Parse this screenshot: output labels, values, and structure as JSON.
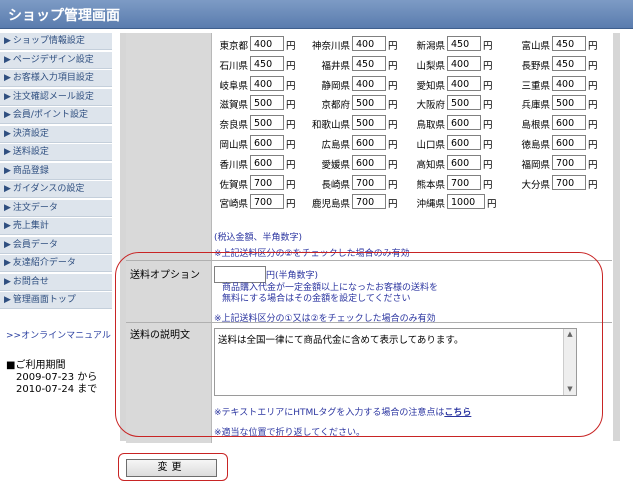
{
  "header": {
    "title": "ショップ管理画面"
  },
  "sidebar": {
    "items": [
      "ショップ情報設定",
      "ページデザイン設定",
      "お客様入力項目設定",
      "注文確認メール設定",
      "会員/ポイント設定",
      "決済設定",
      "送料設定",
      "商品登録",
      "ガイダンスの設定",
      "注文データ",
      "売上集計",
      "会員データ",
      "友達紹介データ",
      "お問合せ",
      "管理画面トップ"
    ],
    "manual": ">>オンラインマニュアル",
    "period_title": "■ご利用期間",
    "period_from": "2009-07-23  から",
    "period_to": "2010-07-24  まで"
  },
  "shipping": {
    "yen": "円",
    "rows": [
      [
        [
          "東京都",
          "400"
        ],
        [
          "神奈川県",
          "400"
        ],
        [
          "新潟県",
          "450"
        ],
        [
          "富山県",
          "450"
        ]
      ],
      [
        [
          "石川県",
          "450"
        ],
        [
          "福井県",
          "450"
        ],
        [
          "山梨県",
          "400"
        ],
        [
          "長野県",
          "450"
        ]
      ],
      [
        [
          "岐阜県",
          "400"
        ],
        [
          "静岡県",
          "400"
        ],
        [
          "愛知県",
          "400"
        ],
        [
          "三重県",
          "400"
        ]
      ],
      [
        [
          "滋賀県",
          "500"
        ],
        [
          "京都府",
          "500"
        ],
        [
          "大阪府",
          "500"
        ],
        [
          "兵庫県",
          "500"
        ]
      ],
      [
        [
          "奈良県",
          "500"
        ],
        [
          "和歌山県",
          "500"
        ],
        [
          "鳥取県",
          "600"
        ],
        [
          "島根県",
          "600"
        ]
      ],
      [
        [
          "岡山県",
          "600"
        ],
        [
          "広島県",
          "600"
        ],
        [
          "山口県",
          "600"
        ],
        [
          "徳島県",
          "600"
        ]
      ],
      [
        [
          "香川県",
          "600"
        ],
        [
          "愛媛県",
          "600"
        ],
        [
          "高知県",
          "600"
        ],
        [
          "福岡県",
          "700"
        ]
      ],
      [
        [
          "佐賀県",
          "700"
        ],
        [
          "長崎県",
          "700"
        ],
        [
          "熊本県",
          "700"
        ],
        [
          "大分県",
          "700"
        ]
      ],
      [
        [
          "宮崎県",
          "700"
        ],
        [
          "鹿児島県",
          "700"
        ],
        [
          "沖縄県",
          "1000"
        ]
      ]
    ],
    "note1": "(税込金額、半角数字)",
    "note2": "※上記送料区分の②をチェックした場合のみ有効"
  },
  "option": {
    "label": "送料オプション",
    "unit": "円(半角数字)",
    "desc1": "商品購入代金が一定金額以上になったお客様の送料を",
    "desc2": "無料にする場合はその金額を設定してください",
    "note": "※上記送料区分の①又は②をチェックした場合のみ有効"
  },
  "explain": {
    "label": "送料の説明文",
    "text": "送料は全国一律にて商品代金に含めて表示してあります。",
    "note1": "※テキストエリアにHTMLタグを入力する場合の注意点は",
    "link": "こちら",
    "note2": "※適当な位置で折り返してください。"
  },
  "submit": {
    "label": "変更"
  }
}
